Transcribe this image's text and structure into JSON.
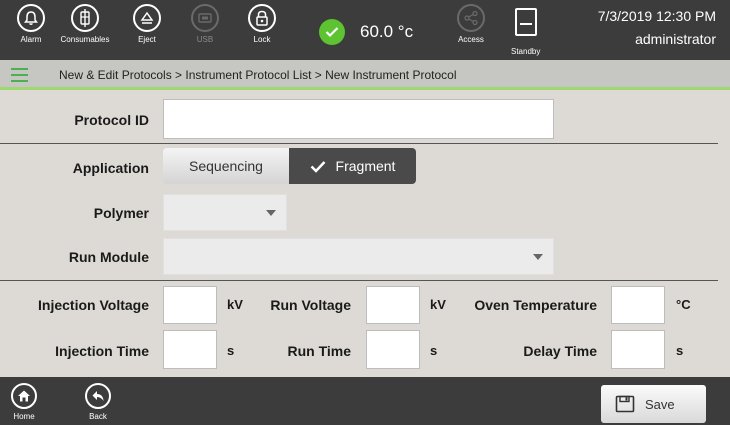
{
  "topbar": {
    "buttons": [
      {
        "label": "Alarm",
        "icon": "alarm-bell-icon"
      },
      {
        "label": "Consumables",
        "icon": "consumables-icon"
      },
      {
        "label": "Eject",
        "icon": "eject-icon"
      },
      {
        "label": "USB",
        "icon": "usb-icon"
      },
      {
        "label": "Lock",
        "icon": "lock-icon"
      }
    ],
    "temperature": "60.0 °c",
    "access_label": "Access",
    "standby_label": "Standby",
    "datetime": "7/3/2019 12:30 PM",
    "user": "administrator"
  },
  "breadcrumb": "New & Edit Protocols > Instrument Protocol List > New Instrument Protocol",
  "form": {
    "protocol_id_label": "Protocol ID",
    "protocol_id_value": "",
    "application_label": "Application",
    "application_options": [
      "Sequencing",
      "Fragment"
    ],
    "application_selected": "Fragment",
    "polymer_label": "Polymer",
    "polymer_value": "",
    "run_module_label": "Run Module",
    "run_module_value": "",
    "injection_voltage_label": "Injection Voltage",
    "injection_voltage_unit": "kV",
    "run_voltage_label": "Run Voltage",
    "run_voltage_unit": "kV",
    "oven_temperature_label": "Oven Temperature",
    "oven_temperature_unit": "°C",
    "injection_time_label": "Injection Time",
    "injection_time_unit": "s",
    "run_time_label": "Run Time",
    "run_time_unit": "s",
    "delay_time_label": "Delay Time",
    "delay_time_unit": "s"
  },
  "bottombar": {
    "home_label": "Home",
    "back_label": "Back",
    "save_label": "Save"
  },
  "colors": {
    "bar_bg": "#3c3c3c",
    "accent_green": "#5ec331",
    "breadcrumb_underline": "#9fd86f",
    "segment_selected": "#4a4a4a"
  }
}
